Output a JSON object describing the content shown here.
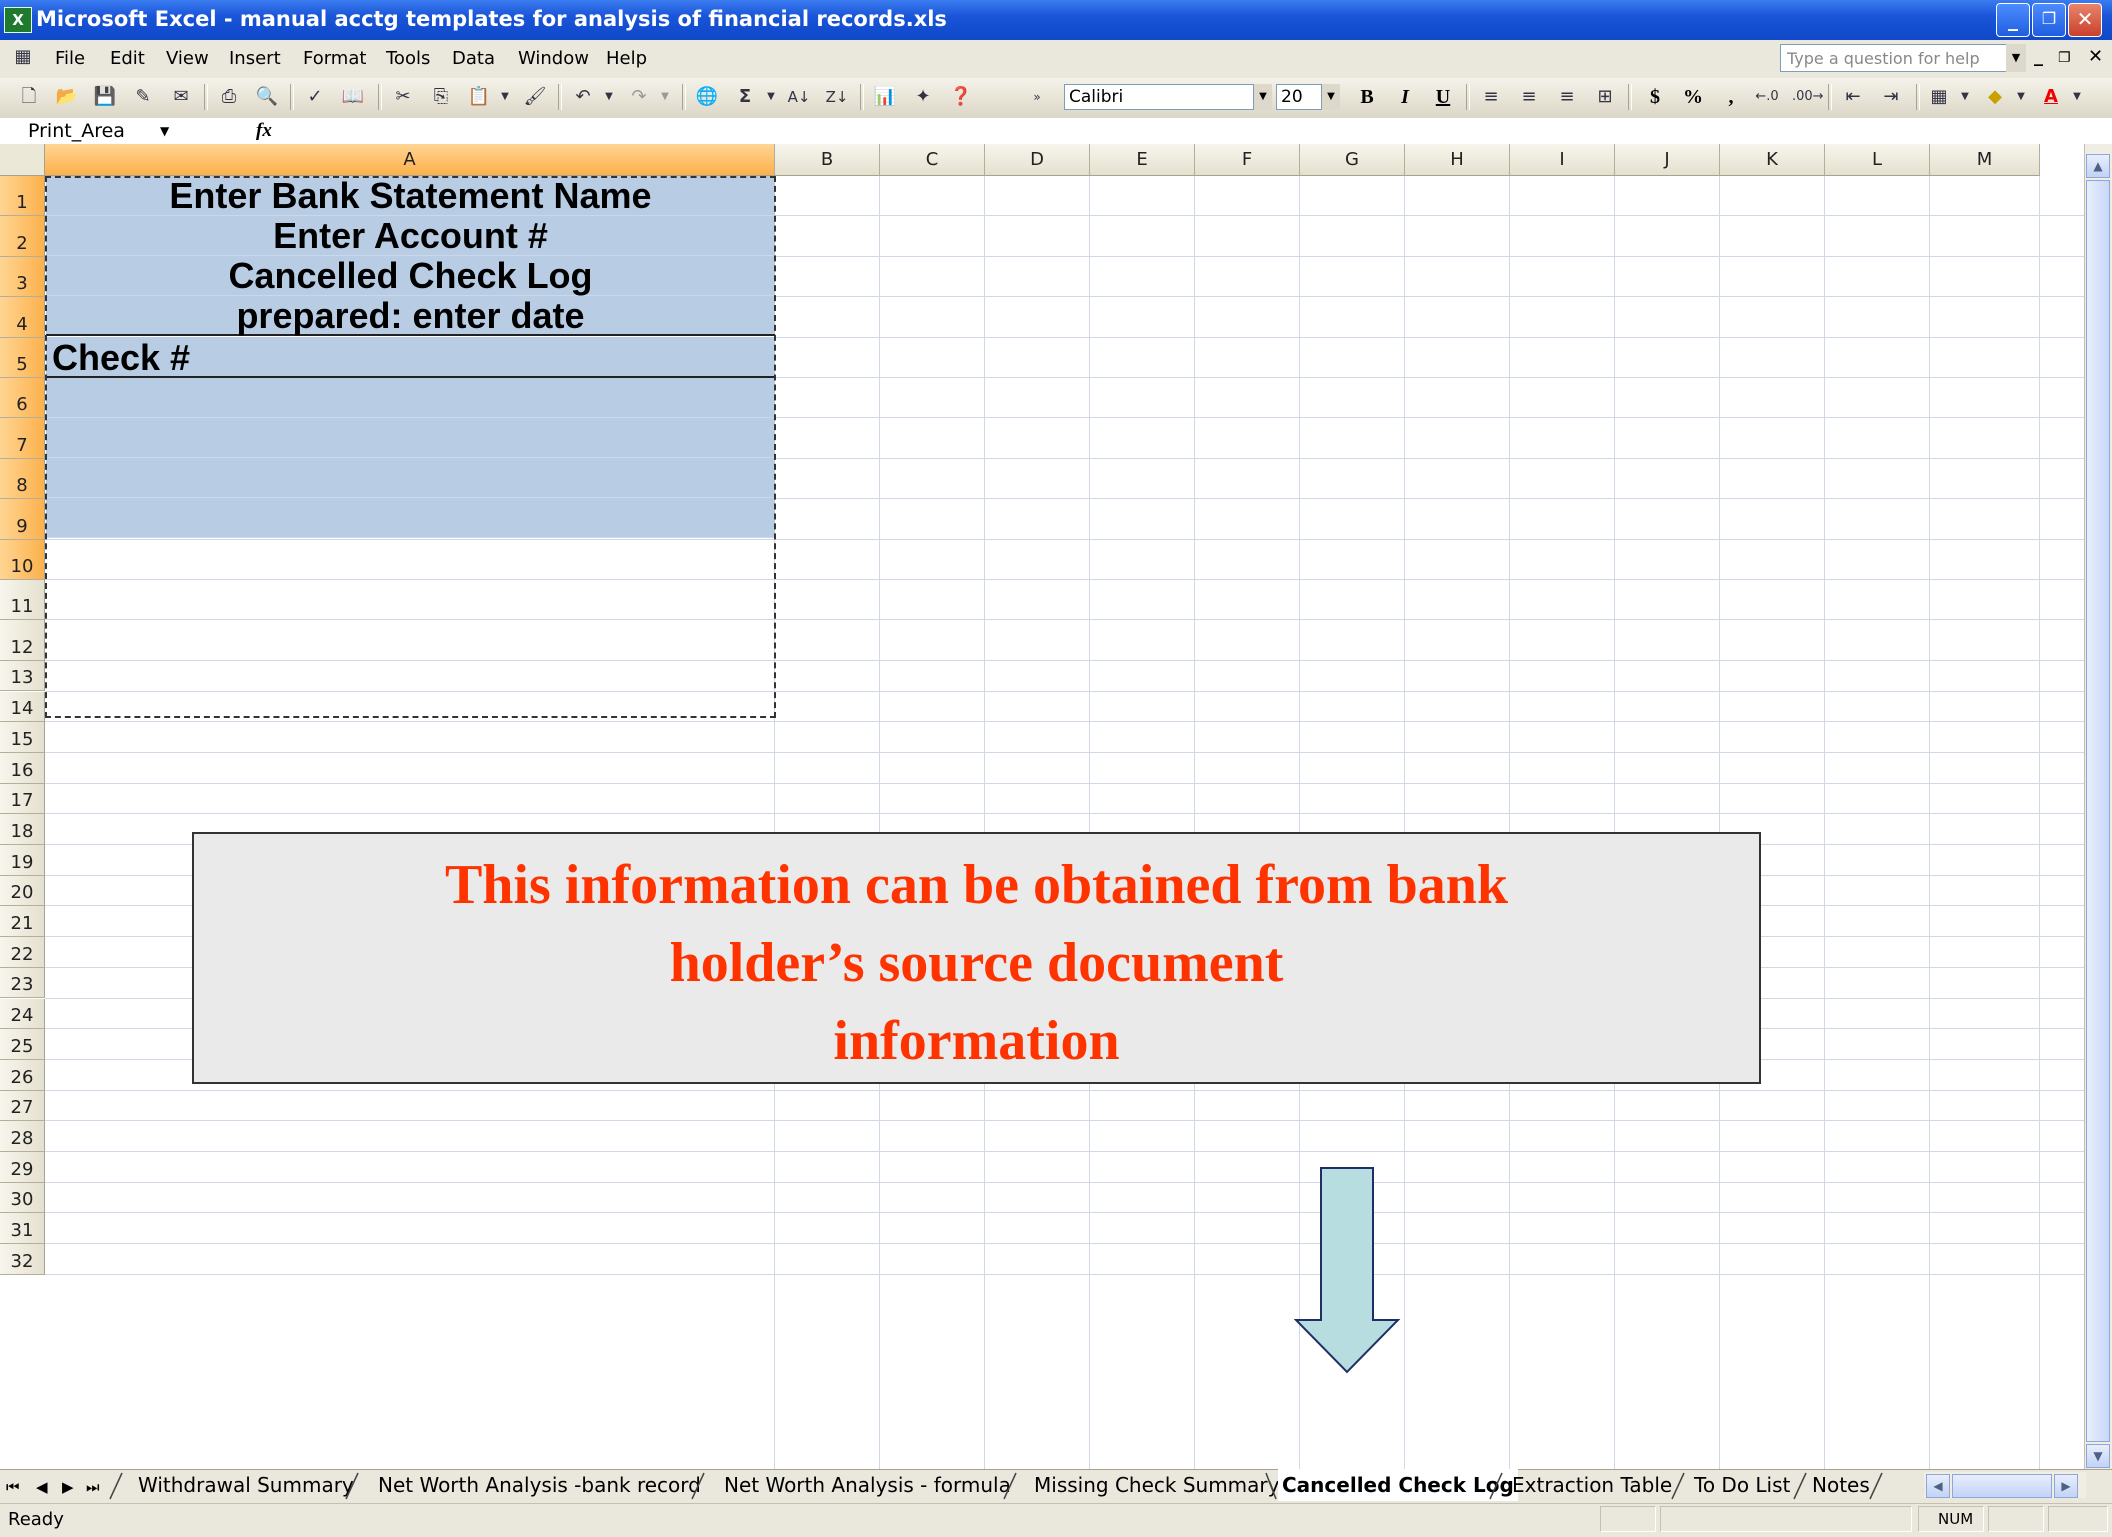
{
  "window": {
    "title": "Microsoft Excel - manual acctg templates for analysis of financial records.xls",
    "minimize": "_",
    "restore": "❐",
    "close": "✕"
  },
  "menu": [
    "File",
    "Edit",
    "View",
    "Insert",
    "Format",
    "Tools",
    "Data",
    "Window",
    "Help"
  ],
  "help_box": {
    "placeholder": "Type a question for help"
  },
  "toolbar": {
    "font_name": "Calibri",
    "font_size": "20",
    "bold": "B",
    "italic": "I",
    "underline": "U",
    "currency": "$",
    "percent": "%",
    "comma": ","
  },
  "formula_bar": {
    "name_box": "Print_Area",
    "fx": "fx"
  },
  "columns": [
    "A",
    "B",
    "C",
    "D",
    "E",
    "F",
    "G",
    "H",
    "I",
    "J",
    "K",
    "L",
    "M"
  ],
  "rows": [
    "1",
    "2",
    "3",
    "4",
    "5",
    "6",
    "7",
    "8",
    "9",
    "10",
    "11",
    "12",
    "13",
    "14",
    "15",
    "16",
    "17",
    "18",
    "19",
    "20",
    "21",
    "22",
    "23",
    "24",
    "25",
    "26",
    "27",
    "28",
    "29",
    "30",
    "31",
    "32"
  ],
  "cells": {
    "a1": "Enter Bank Statement Name",
    "a2": "Enter Account #",
    "a3": "Cancelled Check Log",
    "a4": "prepared: enter date",
    "a5": "Check #"
  },
  "callout": {
    "line1": "This information can be obtained from bank",
    "line2": "holder’s source document",
    "line3": "information"
  },
  "sheet_tabs": [
    "Withdrawal Summary",
    "Net Worth Analysis -bank record",
    "Net Worth Analysis - formula",
    "Missing Check Summary",
    "Cancelled Check Log",
    "Extraction Table",
    "To Do List",
    "Notes"
  ],
  "active_tab": "Cancelled Check Log",
  "status": {
    "ready": "Ready",
    "num": "NUM"
  },
  "colors": {
    "selection_fill": "#b8cce4",
    "callout_text": "#ff3300",
    "arrow_fill": "#b7dde0"
  }
}
